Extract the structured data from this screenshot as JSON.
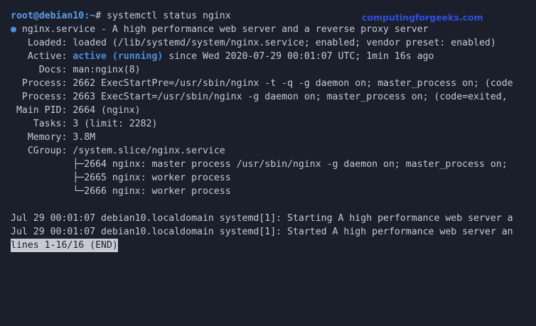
{
  "prompt": {
    "user_host": "root@debian10",
    "path": ":~",
    "symbol": "#",
    "command": " systemctl status nginx"
  },
  "watermark": "computingforgeeks.com",
  "status": {
    "bullet": "●",
    "service_line": " nginx.service - A high performance web server and a reverse proxy server",
    "loaded": "   Loaded: loaded (/lib/systemd/system/nginx.service; enabled; vendor preset: enabled)",
    "active_label": "   Active: ",
    "active_state": "active (running)",
    "active_since": " since Wed 2020-07-29 00:01:07 UTC; 1min 16s ago",
    "docs": "     Docs: man:nginx(8)",
    "process1": "  Process: 2662 ExecStartPre=/usr/sbin/nginx -t -q -g daemon on; master_process on; (code",
    "process2": "  Process: 2663 ExecStart=/usr/sbin/nginx -g daemon on; master_process on; (code=exited,",
    "main_pid": " Main PID: 2664 (nginx)",
    "tasks": "    Tasks: 3 (limit: 2282)",
    "memory": "   Memory: 3.8M",
    "cgroup": "   CGroup: /system.slice/nginx.service",
    "cgroup_tree": [
      "           ├─2664 nginx: master process /usr/sbin/nginx -g daemon on; master_process on;",
      "           ├─2665 nginx: worker process",
      "           └─2666 nginx: worker process"
    ]
  },
  "journal": [
    "Jul 29 00:01:07 debian10.localdomain systemd[1]: Starting A high performance web server a",
    "Jul 29 00:01:07 debian10.localdomain systemd[1]: Started A high performance web server an"
  ],
  "pager_status": "lines 1-16/16 (END)",
  "colors": {
    "background": "#1b1f2b",
    "text": "#c6cad6",
    "accent_blue": "#4c8fe0",
    "watermark": "#2f4fe0"
  }
}
